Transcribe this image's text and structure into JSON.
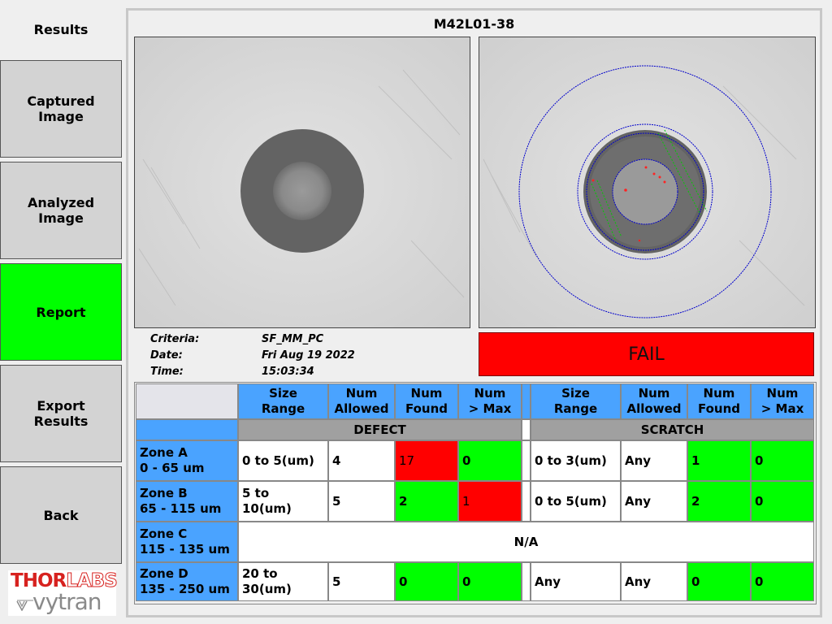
{
  "sidebar": {
    "title": "Results",
    "buttons": [
      {
        "label": "Captured\nImage"
      },
      {
        "label": "Analyzed\nImage"
      },
      {
        "label": "Report"
      },
      {
        "label": "Export\nResults"
      },
      {
        "label": "Back"
      }
    ],
    "active_color": "#00ff00"
  },
  "logo": {
    "top_part1": "THOR",
    "top_part2": "LABS",
    "bottom": "vytran"
  },
  "report": {
    "title": "M42L01-38",
    "info": {
      "criteria_label": "Criteria:",
      "criteria_value": "SF_MM_PC",
      "date_label": "Date:",
      "date_value": "Fri Aug 19 2022",
      "time_label": "Time:",
      "time_value": "15:03:34"
    },
    "result": "FAIL",
    "result_color": "#ff0000"
  },
  "table": {
    "headers": {
      "size_range": "Size\nRange",
      "num_allowed": "Num\nAllowed",
      "num_found": "Num\nFound",
      "num_max": "Num\n> Max"
    },
    "defect_title": "DEFECT",
    "scratch_title": "SCRATCH",
    "na_text": "N/A",
    "zones": [
      {
        "name": "Zone A\n0 - 65 um",
        "defect": {
          "size": "0 to 5(um)",
          "allowed": "4",
          "found": "17",
          "max": "0"
        },
        "scratch": {
          "size": "0 to 3(um)",
          "allowed": "Any",
          "found": "1",
          "max": "0"
        }
      },
      {
        "name": "Zone B\n65 - 115 um",
        "defect": {
          "size": "5 to\n10(um)",
          "allowed": "5",
          "found": "2",
          "max": "1"
        },
        "scratch": {
          "size": "0 to 5(um)",
          "allowed": "Any",
          "found": "2",
          "max": "0"
        }
      },
      {
        "name": "Zone C\n115 - 135 um"
      },
      {
        "name": "Zone D\n135 - 250 um",
        "defect": {
          "size": "20 to\n30(um)",
          "allowed": "5",
          "found": "0",
          "max": "0"
        },
        "scratch": {
          "size": "Any",
          "allowed": "Any",
          "found": "0",
          "max": "0"
        }
      }
    ],
    "status_colors": {
      "pass": "#00ff00",
      "fail": "#ff0000",
      "header": "#4aa3ff"
    }
  }
}
